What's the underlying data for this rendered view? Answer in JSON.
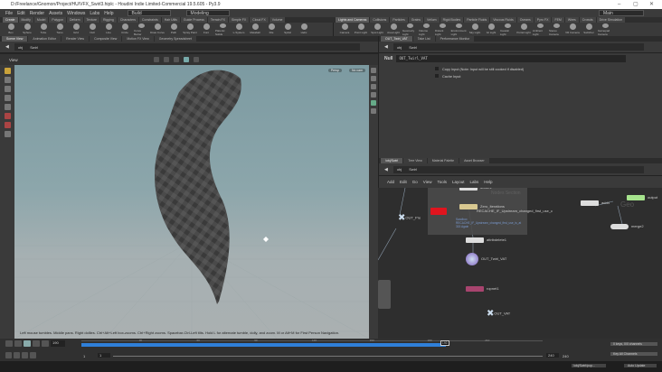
{
  "window": {
    "title": "D:/Freelance/Gnomon/Project/HU/VFX_Swirl3.hiplc - Houdini Indie Limited-Commercial 19.5.605 - Py3.9"
  },
  "menu": [
    "File",
    "Edit",
    "Render",
    "Assets",
    "Windows",
    "Labs",
    "Help"
  ],
  "desktop": "Build",
  "workspace": "Modeling",
  "main_label": "Main",
  "shelf_tabs_left": [
    "Create",
    "Modify",
    "Model",
    "Polygon",
    "Deform",
    "Texture",
    "Rigging",
    "Characters",
    "Constraints",
    "Hair Utils",
    "Guide Process",
    "Terrain FX",
    "Simple FX",
    "Cloud FX",
    "Volume"
  ],
  "shelf_tools_left": [
    "Box",
    "Sphere",
    "Tube",
    "Torus",
    "Grid",
    "Null",
    "Line",
    "Circle",
    "Curve Bezier",
    "Draw Curve",
    "Path",
    "Spray Paint",
    "Font",
    "Platonic Solids",
    "L-System",
    "Metaball",
    "File",
    "Spiral",
    "Helix"
  ],
  "shelf_tabs_right": [
    "Lights and Cameras",
    "Collisions",
    "Particles",
    "Grains",
    "Vellum",
    "Rigid Bodies",
    "Particle Fluids",
    "Viscous Fluids",
    "Oceans",
    "Pyro FX",
    "FEM",
    "Wires",
    "Crowds",
    "Drive Simulation"
  ],
  "shelf_tools_right": [
    "Camera",
    "Point Light",
    "Spot Light",
    "Area Light",
    "Geometry Light",
    "Volume Light",
    "Distant Light",
    "Environment Light",
    "Sky Light",
    "GI Light",
    "Caustic Light",
    "Portal Light",
    "Ambient Light",
    "Stereo Camera",
    "VR Camera",
    "Switcher",
    "Gamepad Camera"
  ],
  "left_pane": {
    "tabs": [
      "Scene View",
      "Animation Editor",
      "Render View",
      "Composite View",
      "Motion FX View",
      "Geometry Spreadsheet"
    ],
    "path": [
      "obj",
      "Swirl"
    ],
    "view_label": "View",
    "persp": "Persp",
    "cam": "No cam",
    "hint": "Left mouse tumbles. Middle pans. Right dollies. Ctrl+Alt+Left box-zooms. Ctrl+Right zooms. Spacebar-Ctrl-Left tilts. Hold L for alternate tumble, dolly, and zoom.    M or Alt+M for First Person Navigation."
  },
  "param_pane": {
    "tabs": [
      "OUT_Twirl_VAT",
      "Take List",
      "Performance Monitor"
    ],
    "path": [
      "obj",
      "Swirl"
    ],
    "node_type": "Null",
    "node_name": "OUT_Twirl_VAT",
    "copy_input": "Copy Input (Note: Input will be still cooked if disabled)",
    "cache_input": "Cache Input"
  },
  "network_pane": {
    "tabs": [
      "/obj/Swirl",
      "Tree View",
      "Material Palette",
      "Asset Browser"
    ],
    "path": [
      "obj",
      "Swirl"
    ],
    "menu": [
      "Add",
      "Edit",
      "Go",
      "View",
      "Tools",
      "Layout",
      "Labs",
      "Help"
    ],
    "box_title": "Nodes Section",
    "netbox_label": "Geo",
    "nodes": {
      "divide": "divide1",
      "zero": "Zero_Iterations",
      "recache": "RECACHE_IF_Upstream_changed_first_use_c",
      "recache_note": "Sandbox RECACHE_IF_Upstream_changed_first_use_is_at 315 Again",
      "out_pre": "OUT_Pre",
      "attribdelete": "attribdelete1",
      "out_twirl": "OUT_Twirl_VAT",
      "ropnet": "ropnet1",
      "out_vat": "OUT_VAT",
      "add": "add4",
      "output": "output",
      "merge": "merge2"
    }
  },
  "timeline": {
    "current_frame": "190",
    "start": "1",
    "start2": "1",
    "end": "240",
    "end2": "240",
    "ticks": [
      "30",
      "60",
      "90",
      "120",
      "150",
      "180",
      "210"
    ],
    "progress": 0.79
  },
  "status": {
    "keys": "0 keys, 0/0 channels",
    "key_all": "Key All Channels",
    "path": "/obj/Swirl/pop...",
    "auto_update": "Auto Update"
  },
  "colors": {
    "accent": "#2f7fd8",
    "recache": "#e0141e",
    "ropnet": "#a8446e",
    "output": "#a6e38d"
  }
}
